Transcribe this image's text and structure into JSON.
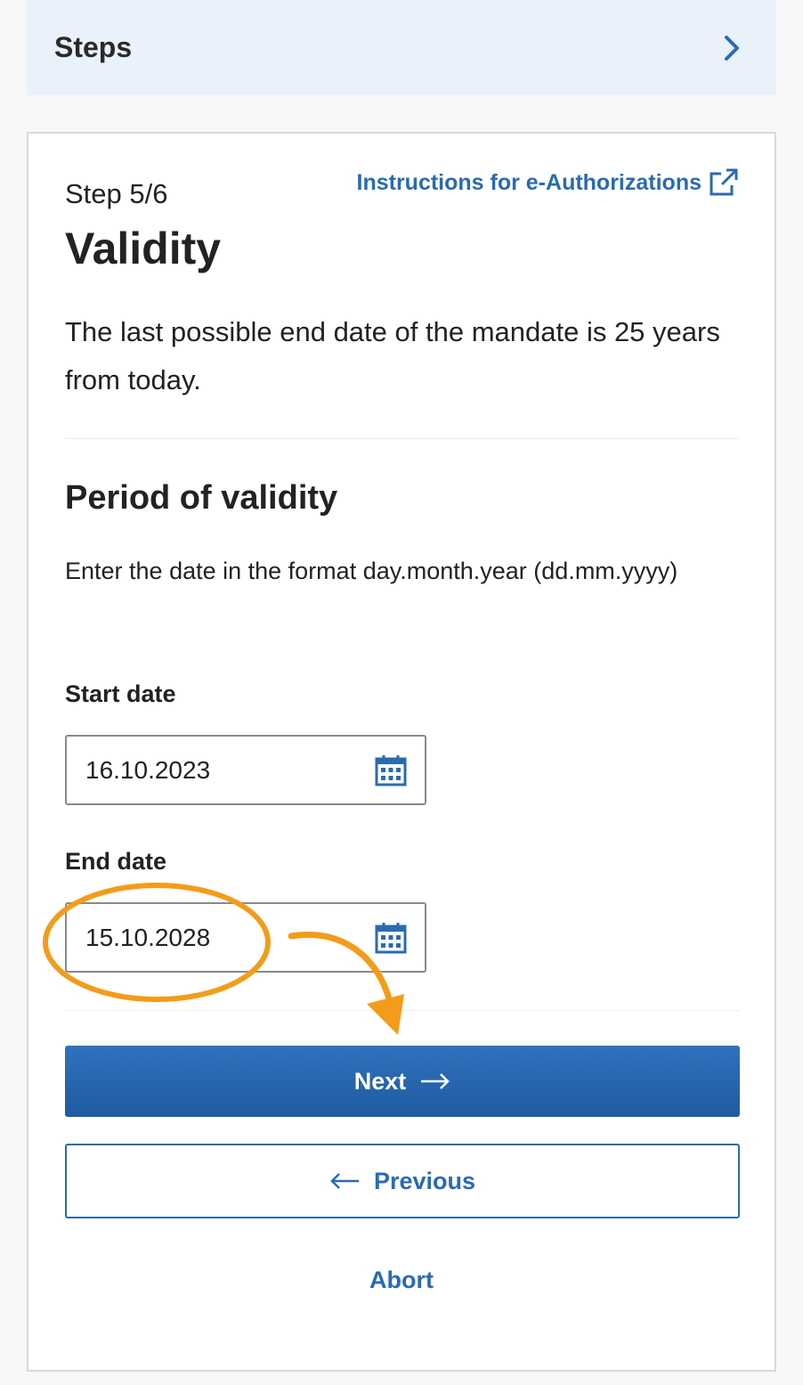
{
  "steps_bar": {
    "label": "Steps",
    "icon": "chevron-right-icon"
  },
  "card": {
    "step_count": "Step 5/6",
    "instructions_link": "Instructions for e-Authorizations",
    "instructions_icon": "external-link-icon",
    "title": "Validity",
    "intro": "The last possible end date of the mandate is 25 years from today.",
    "section_title": "Period of validity",
    "format_hint": "Enter the date in the format day.month.year (dd.mm.yyyy)",
    "start_date": {
      "label": "Start date",
      "value": "16.10.2023",
      "icon": "calendar-icon"
    },
    "end_date": {
      "label": "End date",
      "value": "15.10.2028",
      "icon": "calendar-icon"
    },
    "next_label": "Next",
    "previous_label": "Previous",
    "abort_label": "Abort"
  },
  "colors": {
    "accent": "#2a6bb0",
    "primary_button": "#2565ae",
    "steps_bg": "#e9f1fb",
    "annotation": "#f39c1a"
  }
}
